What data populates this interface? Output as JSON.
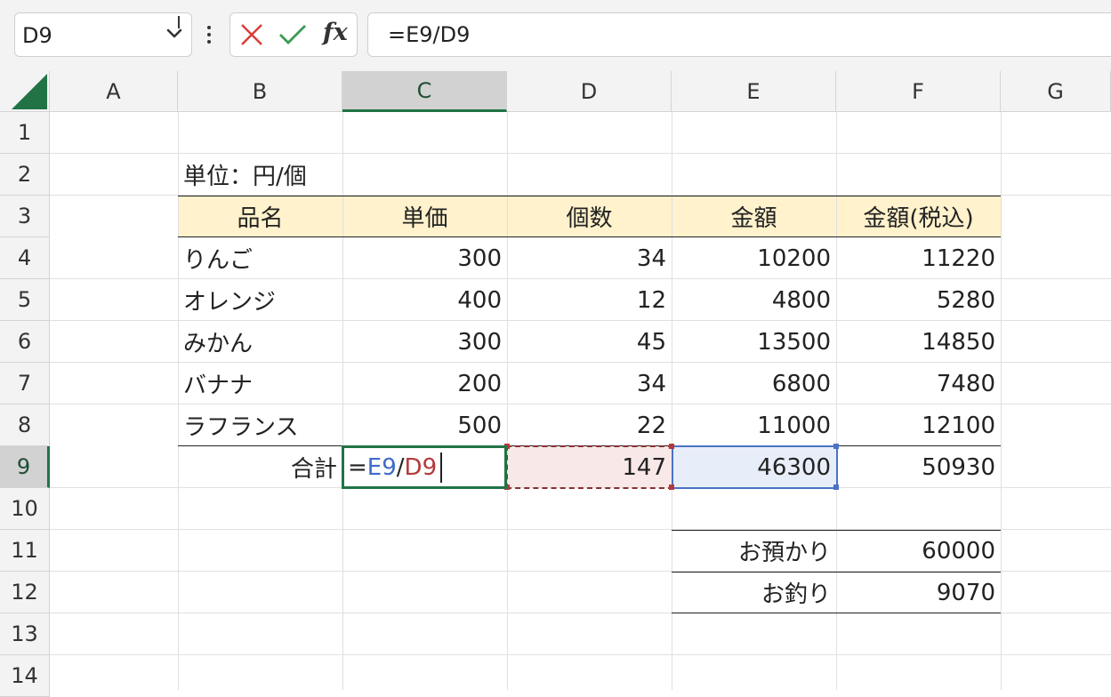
{
  "name_box": {
    "value": "D9"
  },
  "formula_bar": {
    "value": "=E9/D9"
  },
  "icons": {
    "cancel": "close-icon",
    "enter": "check-icon",
    "function": "fx-icon",
    "namebox_dropdown": "chevron-down-icon",
    "more": "vertical-ellipsis-icon",
    "select_all": "select-all-triangle-icon"
  },
  "colors": {
    "header_fill": "#fff2cc",
    "active_cell_border": "#217346",
    "ref_e9": "#4a72c4",
    "ref_d9": "#b5383a"
  },
  "columns": [
    "A",
    "B",
    "C",
    "D",
    "E",
    "F",
    "G"
  ],
  "rows": [
    "1",
    "2",
    "3",
    "4",
    "5",
    "6",
    "7",
    "8",
    "9",
    "10",
    "11",
    "12",
    "13",
    "14"
  ],
  "sheet": {
    "unit_label": "単位：円/個",
    "headers": [
      "品名",
      "単価",
      "個数",
      "金額",
      "金額(税込)"
    ],
    "items": [
      {
        "name": "りんご",
        "price": "300",
        "qty": "34",
        "amount": "10200",
        "amount_tax": "11220"
      },
      {
        "name": "オレンジ",
        "price": "400",
        "qty": "12",
        "amount": "4800",
        "amount_tax": "5280"
      },
      {
        "name": "みかん",
        "price": "300",
        "qty": "45",
        "amount": "13500",
        "amount_tax": "14850"
      },
      {
        "name": "バナナ",
        "price": "200",
        "qty": "34",
        "amount": "6800",
        "amount_tax": "7480"
      },
      {
        "name": "ラフランス",
        "price": "500",
        "qty": "22",
        "amount": "11000",
        "amount_tax": "12100"
      }
    ],
    "total": {
      "label": "合計",
      "qty": "147",
      "amount": "46300",
      "amount_tax": "50930"
    },
    "edit": {
      "eq": "=",
      "ref1": "E9",
      "slash": "/",
      "ref2": "D9"
    },
    "payment": {
      "label": "お預かり",
      "value": "60000"
    },
    "change": {
      "label": "お釣り",
      "value": "9070"
    }
  }
}
